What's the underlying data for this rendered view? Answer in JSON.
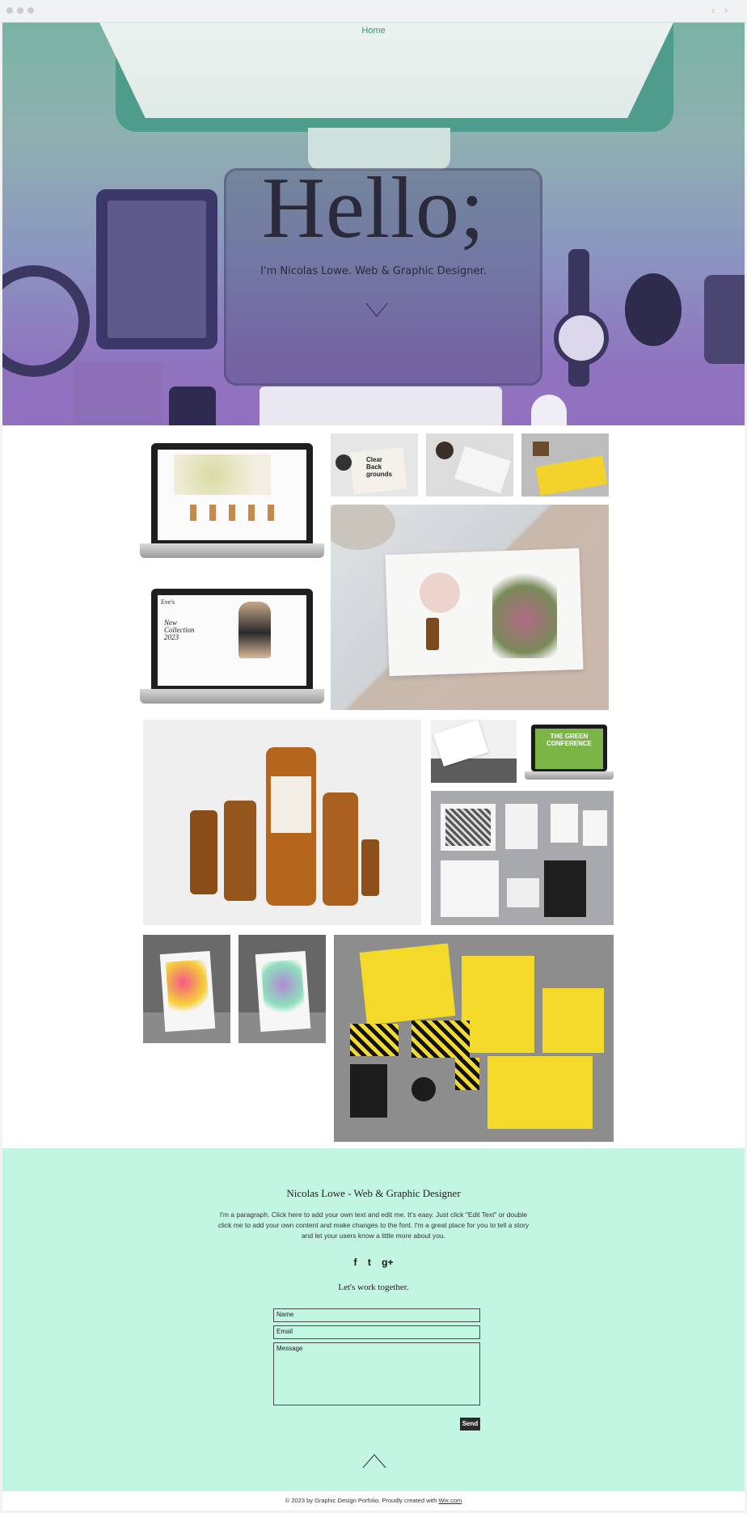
{
  "browser": {
    "back_icon": "chevron-left-icon",
    "forward_icon": "chevron-right-icon"
  },
  "nav": {
    "home": "Home"
  },
  "hero": {
    "title": "Hello;",
    "subtitle": "I'm Nicolas Lowe. Web & Graphic Designer.",
    "scroll_icon": "chevron-down-icon"
  },
  "gallery": {
    "items": [
      {
        "label": "Clear Back grounds"
      },
      {
        "label": "THE GREEN CONFERENCE"
      },
      {
        "label": "New Collection 2023"
      },
      {
        "label": "Eve's"
      }
    ]
  },
  "footer": {
    "title": "Nicolas Lowe - Web & Graphic Designer",
    "paragraph": "I'm a paragraph. Click here to add your own text and edit me. It's easy. Just click \"Edit Text\" or double click me to add your own content and make changes to the font. I'm a great place for you to tell a story and let your users know a little more about you.",
    "social": {
      "facebook": "f",
      "twitter": "t",
      "google": "g+"
    },
    "cta": "Let's work together.",
    "form": {
      "name_placeholder": "Name",
      "email_placeholder": "Email",
      "message_placeholder": "Message",
      "send_label": "Send"
    },
    "top_icon": "chevron-up-icon"
  },
  "copyright": {
    "text": "© 2023 by Graphic Design Porfolio. Proudly created with ",
    "link": "Wix.com"
  },
  "colors": {
    "accent": "#3d8f80",
    "footer_bg": "#c2f6e2",
    "button": "#2b2b2b"
  }
}
